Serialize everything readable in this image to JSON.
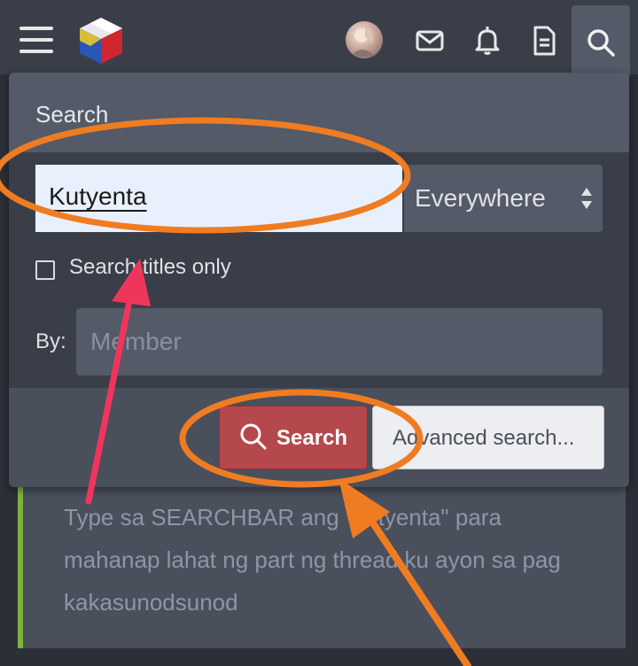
{
  "topbar": {
    "menu_icon": "hamburger-icon",
    "logo_icon": "site-logo-cube-icon",
    "avatar_icon": "user-avatar",
    "icons": [
      "mail-icon",
      "bell-icon",
      "document-icon",
      "search-icon"
    ]
  },
  "search_panel": {
    "title": "Search",
    "keyword_value": "Kutyenta",
    "scope_value": "Everywhere",
    "titles_only_label": "Search titles only",
    "by_label": "By:",
    "member_placeholder": "Member",
    "search_button_label": "Search",
    "advanced_button_label": "Advanced search..."
  },
  "message": {
    "text": "Type sa SEARCHBAR ang \"kutyenta\" para mahanap lahat ng part ng thread ku ayon sa pag kakasunodsunod"
  },
  "colors": {
    "accent_orange": "#f07c22",
    "arrow_pink": "#f0355d",
    "button_red": "#b5484c",
    "quote_green": "#7db33c"
  }
}
